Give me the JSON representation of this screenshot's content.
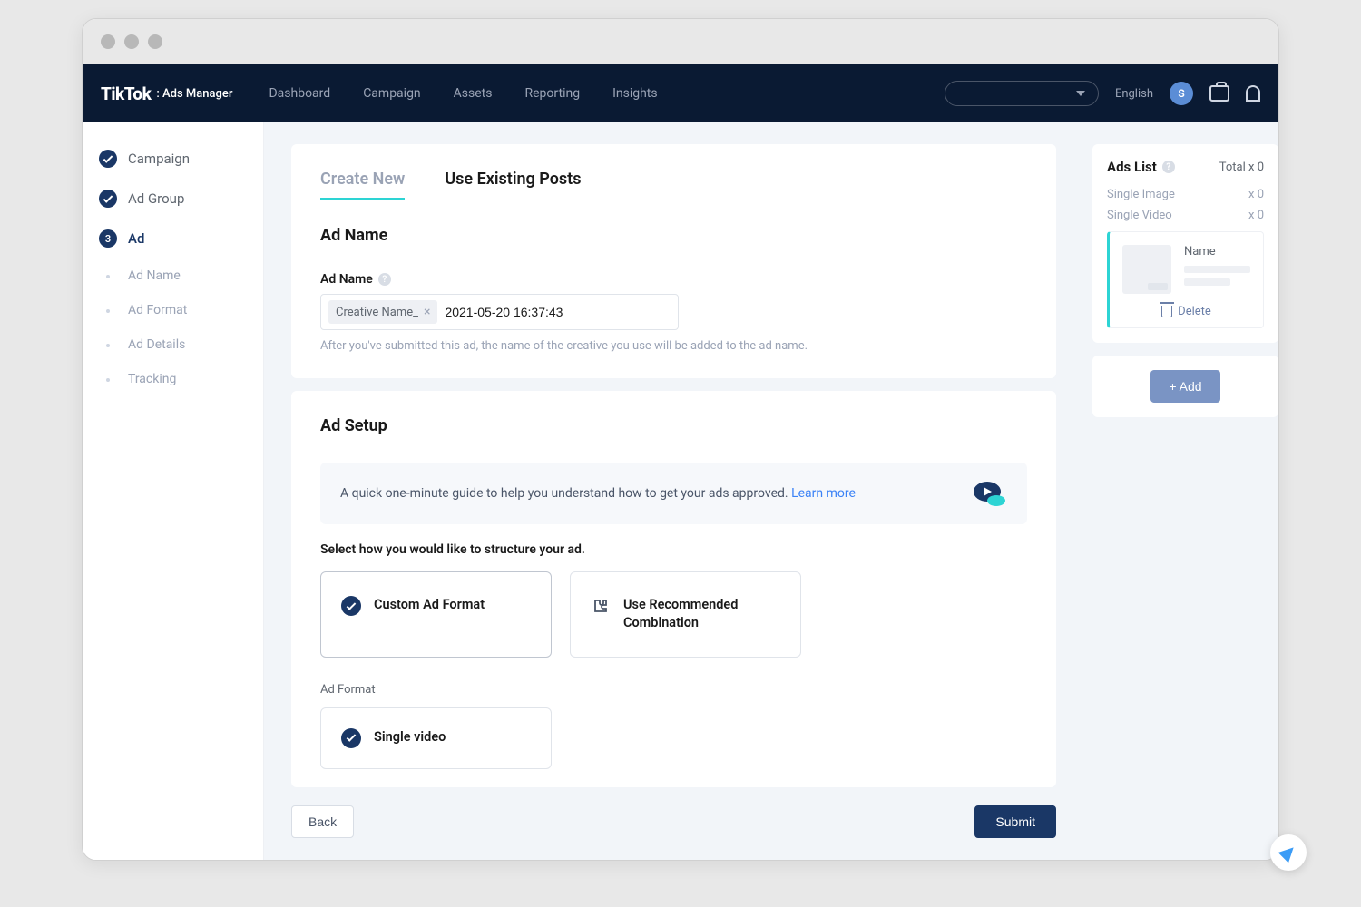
{
  "brand": {
    "name": "TikTok",
    "sub": ": Ads Manager"
  },
  "nav": {
    "items": [
      "Dashboard",
      "Campaign",
      "Assets",
      "Reporting",
      "Insights"
    ],
    "language": "English",
    "avatar_initial": "S"
  },
  "sidebar": {
    "steps": [
      {
        "label": "Campaign",
        "status": "done"
      },
      {
        "label": "Ad Group",
        "status": "done"
      },
      {
        "label": "Ad",
        "status": "active",
        "num": "3"
      }
    ],
    "subs": [
      "Ad Name",
      "Ad Format",
      "Ad Details",
      "Tracking"
    ]
  },
  "tabs": {
    "create": "Create New",
    "existing": "Use Existing Posts"
  },
  "ad_name": {
    "heading": "Ad Name",
    "label": "Ad Name",
    "chip": "Creative Name_",
    "value": "2021-05-20 16:37:43",
    "hint": "After you've submitted this ad, the name of the creative you use will be added to the ad name."
  },
  "ad_setup": {
    "heading": "Ad Setup",
    "notice": "A quick one-minute guide to help you understand how to get your ads approved. ",
    "learn_more": "Learn more",
    "select_text": "Select how you would like to structure your ad.",
    "option1": "Custom Ad Format",
    "option2": "Use Recommended Combination",
    "format_label": "Ad Format",
    "format_value": "Single video"
  },
  "footer": {
    "back": "Back",
    "submit": "Submit"
  },
  "ads_list": {
    "title": "Ads List",
    "total": "Total x 0",
    "rows": [
      {
        "label": "Single Image",
        "count": "x 0"
      },
      {
        "label": "Single Video",
        "count": "x 0"
      }
    ],
    "name": "Name",
    "delete": "Delete",
    "add": "+ Add"
  }
}
